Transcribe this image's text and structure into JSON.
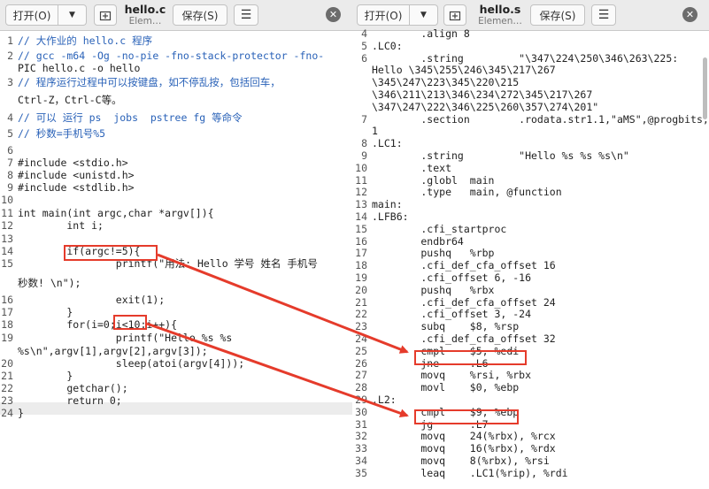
{
  "left_window": {
    "open_label": "打开(O)",
    "title": "hello.c",
    "subtitle": "Elem…",
    "save_label": "保存(S)",
    "lines": [
      {
        "n": "1",
        "text": "// 大作业的 hello.c 程序",
        "comment": true
      },
      {
        "n": "2",
        "text": "// gcc -m64 -Og -no-pie -fno-stack-protector -fno-",
        "comment": true
      },
      {
        "n": "",
        "text": "PIC hello.c -o hello",
        "comment": false
      },
      {
        "n": "3",
        "text": "// 程序运行过程中可以按键盘，如不停乱按，包括回车，",
        "comment": true
      },
      {
        "n": "",
        "text": "Ctrl-Z，Ctrl-C等。",
        "comment": false
      },
      {
        "n": "4",
        "text": "// 可以 运行 ps  jobs  pstree fg 等命令",
        "comment": true
      },
      {
        "n": "5",
        "text": "// 秒数=手机号%5",
        "comment": true
      },
      {
        "n": "6",
        "text": "",
        "comment": false
      },
      {
        "n": "7",
        "text": "#include <stdio.h>",
        "comment": false
      },
      {
        "n": "8",
        "text": "#include <unistd.h>",
        "comment": false
      },
      {
        "n": "9",
        "text": "#include <stdlib.h>",
        "comment": false
      },
      {
        "n": "10",
        "text": "",
        "comment": false
      },
      {
        "n": "11",
        "text": "int main(int argc,char *argv[]){",
        "comment": false
      },
      {
        "n": "12",
        "text": "        int i;",
        "comment": false
      },
      {
        "n": "13",
        "text": "",
        "comment": false
      },
      {
        "n": "14",
        "text": "        if(argc!=5){",
        "comment": false
      },
      {
        "n": "15",
        "text": "                printf(\"用法: Hello 学号 姓名 手机号",
        "comment": false
      },
      {
        "n": "",
        "text": "秒数! \\n\");",
        "comment": false
      },
      {
        "n": "16",
        "text": "                exit(1);",
        "comment": false
      },
      {
        "n": "17",
        "text": "        }",
        "comment": false
      },
      {
        "n": "18",
        "text": "        for(i=0;i<10;i++){",
        "comment": false
      },
      {
        "n": "19",
        "text": "                printf(\"Hello %s %s",
        "comment": false
      },
      {
        "n": "",
        "text": "%s\\n\",argv[1],argv[2],argv[3]);",
        "comment": false
      },
      {
        "n": "20",
        "text": "                sleep(atoi(argv[4]));",
        "comment": false
      },
      {
        "n": "21",
        "text": "        }",
        "comment": false
      },
      {
        "n": "22",
        "text": "        getchar();",
        "comment": false
      },
      {
        "n": "23",
        "text": "        return 0;",
        "comment": false
      },
      {
        "n": "24",
        "text": "}",
        "comment": false
      }
    ]
  },
  "right_window": {
    "open_label": "打开(O)",
    "title": "hello.s",
    "subtitle": "Elemen…",
    "save_label": "保存(S)",
    "lines": [
      {
        "n": "4",
        "text": "        .align 8"
      },
      {
        "n": "5",
        "text": ".LC0:"
      },
      {
        "n": "6",
        "text": "        .string         \"\\347\\224\\250\\346\\263\\225:"
      },
      {
        "n": "",
        "text": "Hello \\345\\255\\246\\345\\217\\267"
      },
      {
        "n": "",
        "text": "\\345\\247\\223\\345\\220\\215"
      },
      {
        "n": "",
        "text": "\\346\\211\\213\\346\\234\\272\\345\\217\\267"
      },
      {
        "n": "",
        "text": "\\347\\247\\222\\346\\225\\260\\357\\274\\201\""
      },
      {
        "n": "7",
        "text": "        .section        .rodata.str1.1,\"aMS\",@progbits,"
      },
      {
        "n": "",
        "text": "1"
      },
      {
        "n": "8",
        "text": ".LC1:"
      },
      {
        "n": "9",
        "text": "        .string         \"Hello %s %s %s\\n\""
      },
      {
        "n": "10",
        "text": "        .text"
      },
      {
        "n": "11",
        "text": "        .globl  main"
      },
      {
        "n": "12",
        "text": "        .type   main, @function"
      },
      {
        "n": "13",
        "text": "main:"
      },
      {
        "n": "14",
        "text": ".LFB6:"
      },
      {
        "n": "15",
        "text": "        .cfi_startproc"
      },
      {
        "n": "16",
        "text": "        endbr64"
      },
      {
        "n": "17",
        "text": "        pushq   %rbp"
      },
      {
        "n": "18",
        "text": "        .cfi_def_cfa_offset 16"
      },
      {
        "n": "19",
        "text": "        .cfi_offset 6, -16"
      },
      {
        "n": "20",
        "text": "        pushq   %rbx"
      },
      {
        "n": "21",
        "text": "        .cfi_def_cfa_offset 24"
      },
      {
        "n": "22",
        "text": "        .cfi_offset 3, -24"
      },
      {
        "n": "23",
        "text": "        subq    $8, %rsp"
      },
      {
        "n": "24",
        "text": "        .cfi_def_cfa_offset 32"
      },
      {
        "n": "25",
        "text": "        cmpl    $5, %edi"
      },
      {
        "n": "26",
        "text": "        jne     .L6"
      },
      {
        "n": "27",
        "text": "        movq    %rsi, %rbx"
      },
      {
        "n": "28",
        "text": "        movl    $0, %ebp"
      },
      {
        "n": "29",
        "text": ".L2:"
      },
      {
        "n": "30",
        "text": "        cmpl    $9, %ebp"
      },
      {
        "n": "31",
        "text": "        jg      .L7"
      },
      {
        "n": "32",
        "text": "        movq    24(%rbx), %rcx"
      },
      {
        "n": "33",
        "text": "        movq    16(%rbx), %rdx"
      },
      {
        "n": "34",
        "text": "        movq    8(%rbx), %rsi"
      },
      {
        "n": "35",
        "text": "        leaq    .LC1(%rip), %rdi"
      }
    ]
  },
  "colors": {
    "annotation": "#e53b2b",
    "comment": "#2a62b8"
  }
}
